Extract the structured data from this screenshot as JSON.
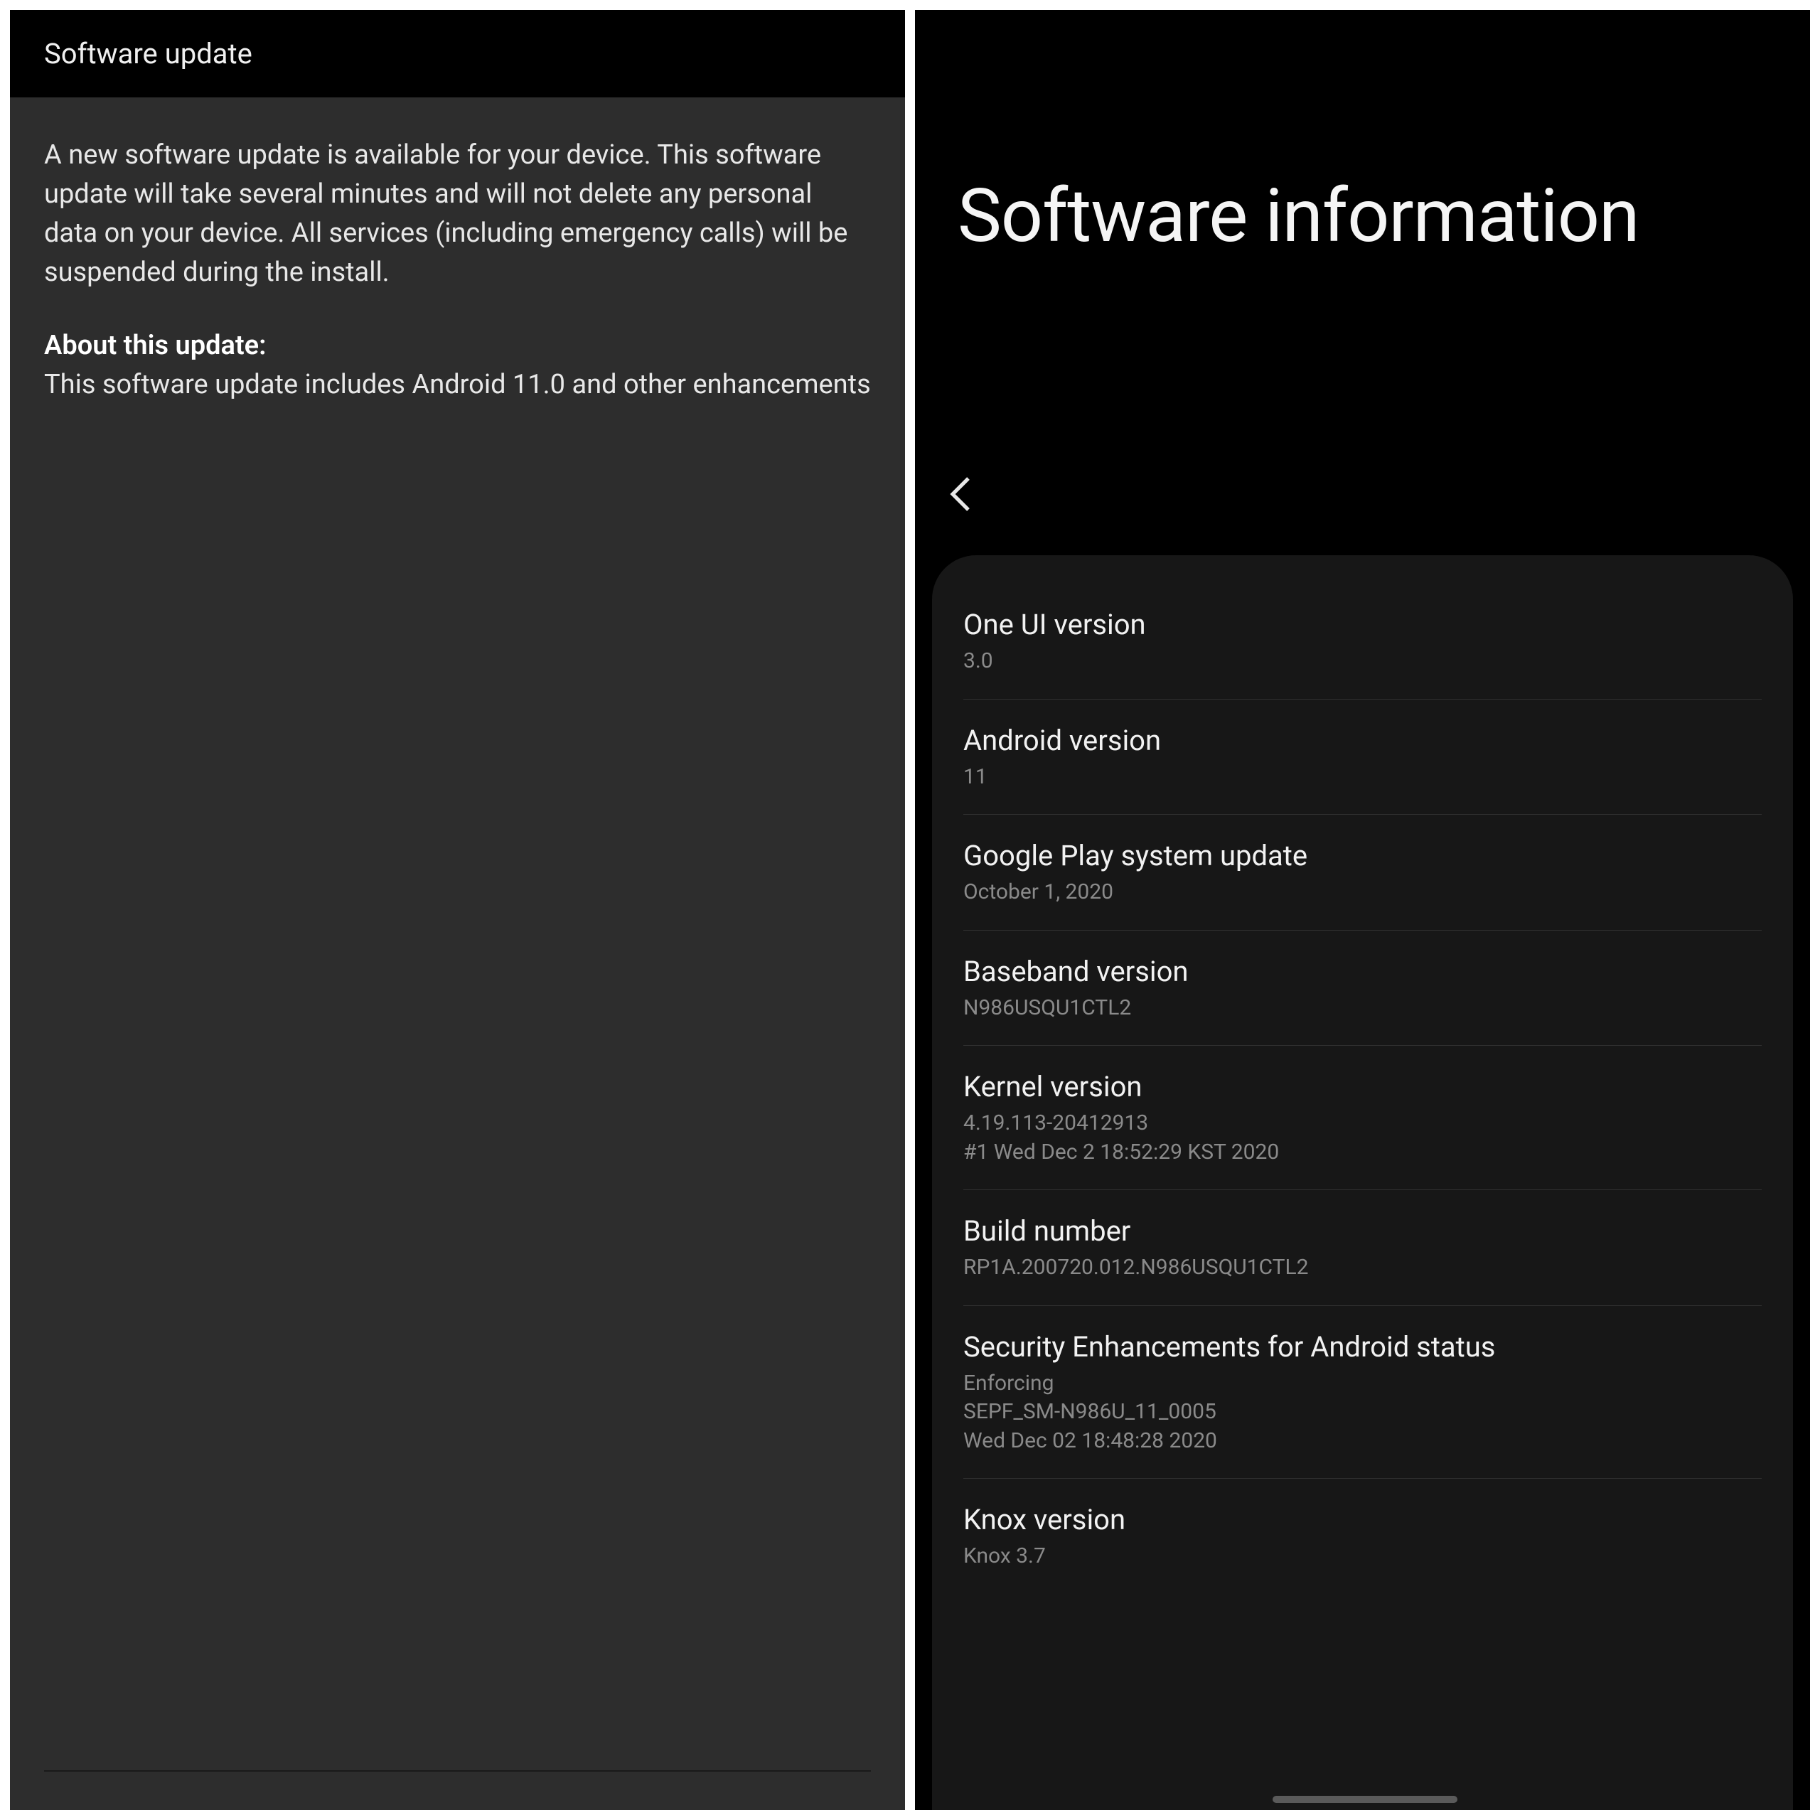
{
  "left": {
    "header_title": "Software update",
    "intro": "A new software update is available for your device. This software update will take several minutes and will not delete any personal data on your device. All services (including emergency calls) will be suspended during the install.",
    "about_label": "About this update:",
    "about_text": "This software update includes Android 11.0 and other enhancements"
  },
  "right": {
    "title": "Software information",
    "rows": [
      {
        "label": "One UI version",
        "value": "3.0"
      },
      {
        "label": "Android version",
        "value": "11"
      },
      {
        "label": "Google Play system update",
        "value": "October 1, 2020"
      },
      {
        "label": "Baseband version",
        "value": "N986USQU1CTL2"
      },
      {
        "label": "Kernel version",
        "value": "4.19.113-20412913\n#1 Wed Dec 2 18:52:29 KST 2020"
      },
      {
        "label": "Build number",
        "value": "RP1A.200720.012.N986USQU1CTL2"
      },
      {
        "label": "Security Enhancements for Android status",
        "value": "Enforcing\nSEPF_SM-N986U_11_0005\nWed Dec 02 18:48:28 2020"
      },
      {
        "label": "Knox version",
        "value": "Knox 3.7"
      }
    ]
  }
}
